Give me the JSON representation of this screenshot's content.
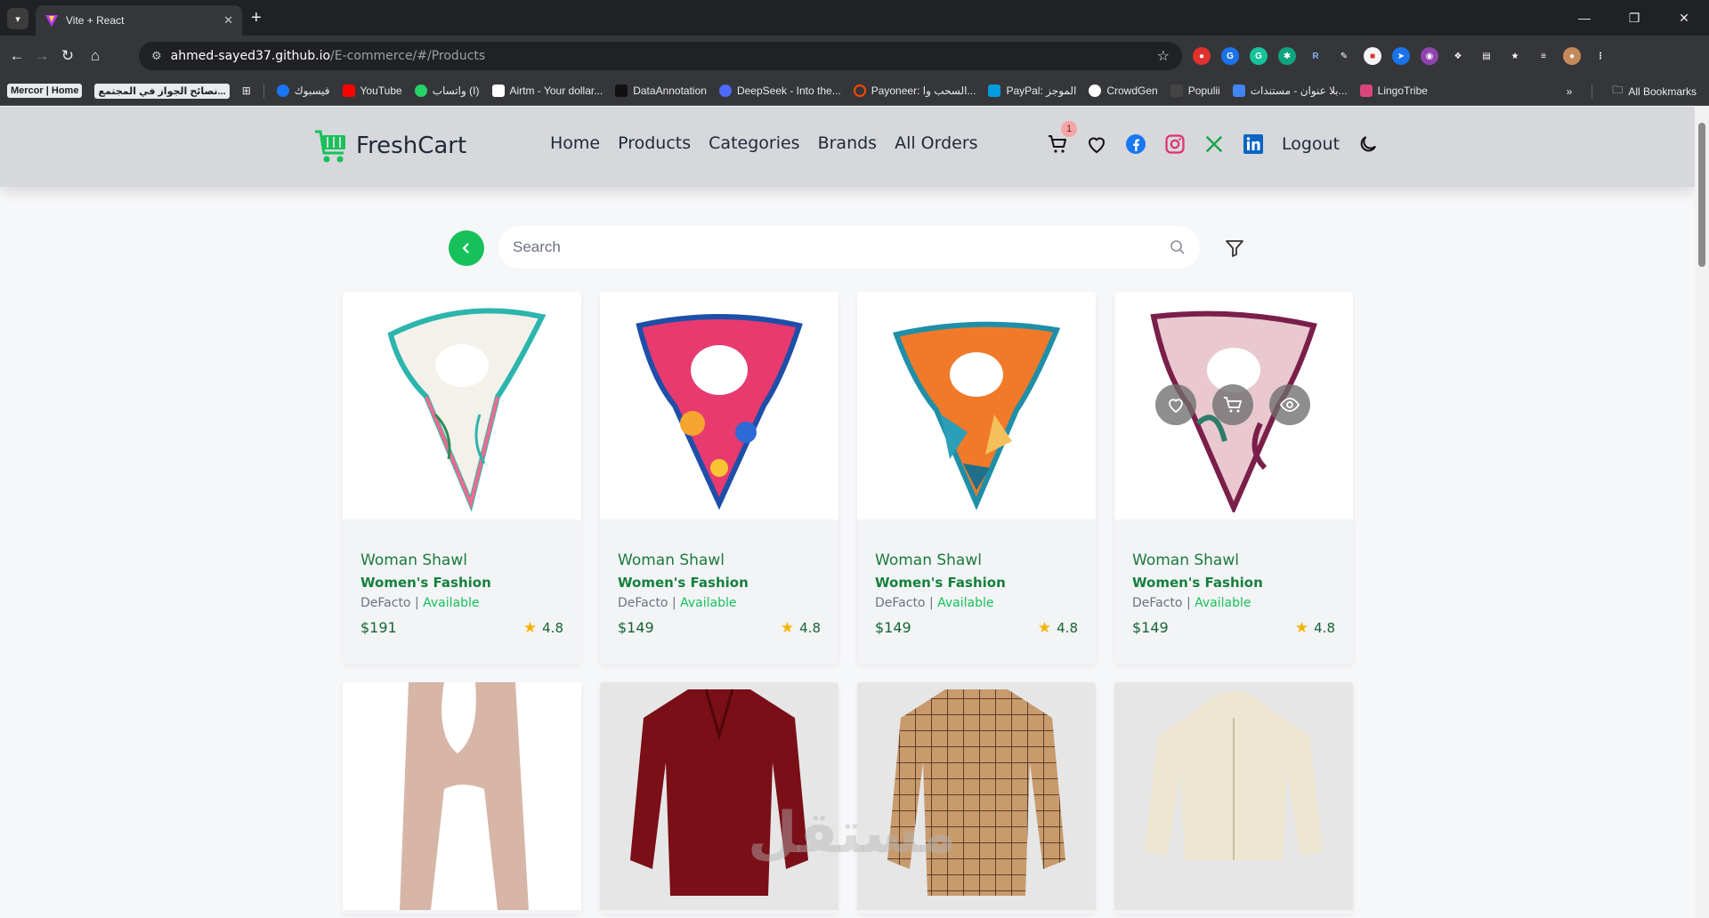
{
  "browser": {
    "tab_title": "Vite + React",
    "url_host": "ahmed-sayed37.github.io",
    "url_path": "/E-commerce/#/Products",
    "bookmarks": [
      {
        "label": "Mercor | Home",
        "color": "#e8eaed"
      },
      {
        "label": "نصائح الجواز في المجتمع...",
        "color": "#e8eaed"
      },
      {
        "label": "فيسبوك",
        "color": "#1877f2"
      },
      {
        "label": "YouTube",
        "color": "#ff0000"
      },
      {
        "label": "واتساب (I)",
        "color": "#25d366"
      },
      {
        "label": "Airtm - Your dollar...",
        "color": "#ffffff"
      },
      {
        "label": "DataAnnotation",
        "color": "#222222"
      },
      {
        "label": "DeepSeek - Into the...",
        "color": "#4d6bfe"
      },
      {
        "label": "Payoneer: السحب وا...",
        "color": "#ff4800"
      },
      {
        "label": "PayPal: الموجز",
        "color": "#003087"
      },
      {
        "label": "CrowdGen",
        "color": "#ffffff"
      },
      {
        "label": "Populii",
        "color": "#333333"
      },
      {
        "label": "بلا عنوان - مستندات...",
        "color": "#4285f4"
      },
      {
        "label": "LingoTribe",
        "color": "#d9467a"
      }
    ],
    "all_bookmarks": "All Bookmarks"
  },
  "site": {
    "logo": "FreshCart",
    "nav": [
      "Home",
      "Products",
      "Categories",
      "Brands",
      "All Orders"
    ],
    "wishlist_count": "1",
    "logout": "Logout",
    "brand_color": "#16c15a"
  },
  "search": {
    "placeholder": "Search"
  },
  "products": [
    {
      "name": "Woman Shawl",
      "category": "Women's Fashion",
      "brand": "DeFacto",
      "status": "Available",
      "price": "$191",
      "rating": "4.8"
    },
    {
      "name": "Woman Shawl",
      "category": "Women's Fashion",
      "brand": "DeFacto",
      "status": "Available",
      "price": "$149",
      "rating": "4.8"
    },
    {
      "name": "Woman Shawl",
      "category": "Women's Fashion",
      "brand": "DeFacto",
      "status": "Available",
      "price": "$149",
      "rating": "4.8"
    },
    {
      "name": "Woman Shawl",
      "category": "Women's Fashion",
      "brand": "DeFacto",
      "status": "Available",
      "price": "$149",
      "rating": "4.8"
    }
  ],
  "watermark": "مستقل"
}
